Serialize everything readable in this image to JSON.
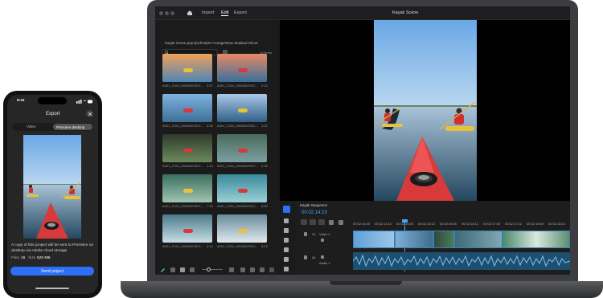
{
  "laptop": {
    "menu": {
      "import": "Import",
      "edit": "Edit",
      "export": "Export"
    },
    "window_title": "Kayak Scene",
    "bin_path": "Kayak Scene.prproj\\Lifestyle Footage\\New Zealand Shoot",
    "items_count": "10 items",
    "clips": [
      {
        "name": "A001_C024_00026M.RDC...",
        "duration": "2:07"
      },
      {
        "name": "A001_C024_00026M.RDC...",
        "duration": "2:13"
      },
      {
        "name": "A001_C024_00026M.RDC...",
        "duration": "2:08"
      },
      {
        "name": "A001_C024_00026M.RDC...",
        "duration": "1:22"
      },
      {
        "name": "A001_C024_00026M.RDC...",
        "duration": "1:19"
      },
      {
        "name": "A001_C024_00026M.RDC...",
        "duration": "2:28"
      },
      {
        "name": "A001_C024_00026M.RDC...",
        "duration": "7:15"
      },
      {
        "name": "A001_C024_00026M.RDC...",
        "duration": "4:02"
      },
      {
        "name": "A001_C024_00026M.RDC...",
        "duration": "2:24"
      },
      {
        "name": "A001_C024_00026M.RDC...",
        "duration": "3:13"
      }
    ],
    "timeline": {
      "sequence_name": "Kayak Sequence",
      "timecode": "00:02:14:23",
      "ruler": [
        "00:02:14:00",
        "00:02:14:12",
        "00:02:15:00",
        "00:02:15:12",
        "00:02:16:00",
        "00:02:16:12",
        "00:02:17:00",
        "00:02:17:12",
        "00:02:18:00",
        "00:02:18:12"
      ],
      "video_track": "V1",
      "video_track_name": "Video 1",
      "audio_track": "A1",
      "audio_track_name": "Audio 1"
    }
  },
  "phone": {
    "time": "9:41",
    "title": "Export",
    "tabs": [
      "Video",
      "Premiere desktop"
    ],
    "description": "A copy of this project will be sent to Premiere on desktop via Adobe cloud storage",
    "files_label": "Files",
    "files_value": "16",
    "size_label": "Size",
    "size_value": "520 MB",
    "send_button": "Send project"
  },
  "colors": {
    "accent": "#2d6ff7",
    "timecode": "#4aa0ff",
    "kayak": "#d63a3a"
  }
}
